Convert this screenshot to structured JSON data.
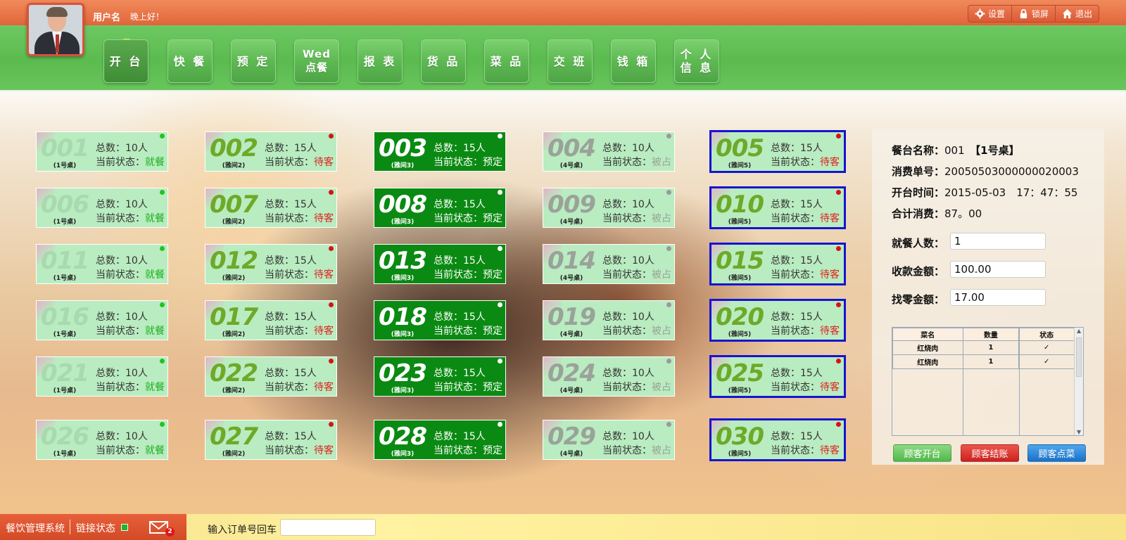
{
  "header": {
    "username": "用户名",
    "greeting": "晚上好！",
    "tools": [
      {
        "label": "设置",
        "icon": "gear-icon"
      },
      {
        "label": "锁屏",
        "icon": "lock-icon"
      },
      {
        "label": "退出",
        "icon": "home-icon"
      }
    ]
  },
  "nav": {
    "active": "开台",
    "items": [
      {
        "label": "开 台"
      },
      {
        "label": "快 餐"
      },
      {
        "label": "预 定"
      },
      {
        "line1": "Wed",
        "line2": "点餐"
      },
      {
        "label": "报 表"
      },
      {
        "label": "货 品"
      },
      {
        "label": "菜 品"
      },
      {
        "label": "交 班"
      },
      {
        "label": "钱 箱"
      },
      {
        "line1": "个 人",
        "line2": "信 息"
      }
    ]
  },
  "tables": {
    "total_prefix": "总数：",
    "state_prefix": "当前状态：",
    "rows": [
      [
        {
          "num": "001",
          "room": "(1号桌)",
          "count": "10人",
          "state": "就餐"
        },
        {
          "num": "002",
          "room": "(雅间2)",
          "count": "15人",
          "state": "待客"
        },
        {
          "num": "003",
          "room": "(雅间3)",
          "count": "15人",
          "state": "预定"
        },
        {
          "num": "004",
          "room": "(4号桌)",
          "count": "10人",
          "state": "被占"
        },
        {
          "num": "005",
          "room": "(雅间5)",
          "count": "15人",
          "state": "待客"
        }
      ],
      [
        {
          "num": "006",
          "room": "(1号桌)",
          "count": "10人",
          "state": "就餐"
        },
        {
          "num": "007",
          "room": "(雅间2)",
          "count": "15人",
          "state": "待客"
        },
        {
          "num": "008",
          "room": "(雅间3)",
          "count": "15人",
          "state": "预定"
        },
        {
          "num": "009",
          "room": "(4号桌)",
          "count": "10人",
          "state": "被占"
        },
        {
          "num": "010",
          "room": "(雅间5)",
          "count": "15人",
          "state": "待客"
        }
      ],
      [
        {
          "num": "011",
          "room": "(1号桌)",
          "count": "10人",
          "state": "就餐"
        },
        {
          "num": "012",
          "room": "(雅间2)",
          "count": "15人",
          "state": "待客"
        },
        {
          "num": "013",
          "room": "(雅间3)",
          "count": "15人",
          "state": "预定"
        },
        {
          "num": "014",
          "room": "(4号桌)",
          "count": "10人",
          "state": "被占"
        },
        {
          "num": "015",
          "room": "(雅间5)",
          "count": "15人",
          "state": "待客"
        }
      ],
      [
        {
          "num": "016",
          "room": "(1号桌)",
          "count": "10人",
          "state": "就餐"
        },
        {
          "num": "017",
          "room": "(雅间2)",
          "count": "15人",
          "state": "待客"
        },
        {
          "num": "018",
          "room": "(雅间3)",
          "count": "15人",
          "state": "预定"
        },
        {
          "num": "019",
          "room": "(4号桌)",
          "count": "10人",
          "state": "被占"
        },
        {
          "num": "020",
          "room": "(雅间5)",
          "count": "15人",
          "state": "待客"
        }
      ],
      [
        {
          "num": "021",
          "room": "(1号桌)",
          "count": "10人",
          "state": "就餐"
        },
        {
          "num": "022",
          "room": "(雅间2)",
          "count": "15人",
          "state": "待客"
        },
        {
          "num": "023",
          "room": "(雅间3)",
          "count": "15人",
          "state": "预定"
        },
        {
          "num": "024",
          "room": "(4号桌)",
          "count": "10人",
          "state": "被占"
        },
        {
          "num": "025",
          "room": "(雅间5)",
          "count": "15人",
          "state": "待客"
        }
      ],
      [
        {
          "num": "026",
          "room": "(1号桌)",
          "count": "10人",
          "state": "就餐"
        },
        {
          "num": "027",
          "room": "(雅间2)",
          "count": "15人",
          "state": "待客"
        },
        {
          "num": "028",
          "room": "(雅间3)",
          "count": "15人",
          "state": "预定"
        },
        {
          "num": "029",
          "room": "(4号桌)",
          "count": "10人",
          "state": "被占"
        },
        {
          "num": "030",
          "room": "(雅间5)",
          "count": "15人",
          "state": "待客"
        }
      ]
    ]
  },
  "panel": {
    "table_name_label": "餐台名称：",
    "table_name_value": "001",
    "table_name_extra": "【1号桌】",
    "order_label": "消费单号：",
    "order_value": "20050503000000020003",
    "open_time_label": "开台时间：",
    "open_time_value": "2015-05-03　17：47：55",
    "total_label": "合计消费：",
    "total_value": "87。00",
    "diners_label": "就餐人数：",
    "diners_value": "1",
    "received_label": "收款金额：",
    "received_value": "100.00",
    "change_label": "找零金额：",
    "change_value": "17.00",
    "grid_headers": [
      "菜名",
      "数量",
      "状态"
    ],
    "grid_rows": [
      {
        "name": "红烧肉",
        "qty": "1",
        "status": "✓"
      },
      {
        "name": "红烧肉",
        "qty": "1",
        "status": "✓"
      }
    ],
    "buttons": {
      "open": "顾客开台",
      "checkout": "顾客结账",
      "order": "顾客点菜"
    }
  },
  "footer": {
    "system": "餐饮管理系统",
    "link": "链接状态",
    "mail_count": "2",
    "order_input_label": "输入订单号回车",
    "order_input_value": ""
  }
}
